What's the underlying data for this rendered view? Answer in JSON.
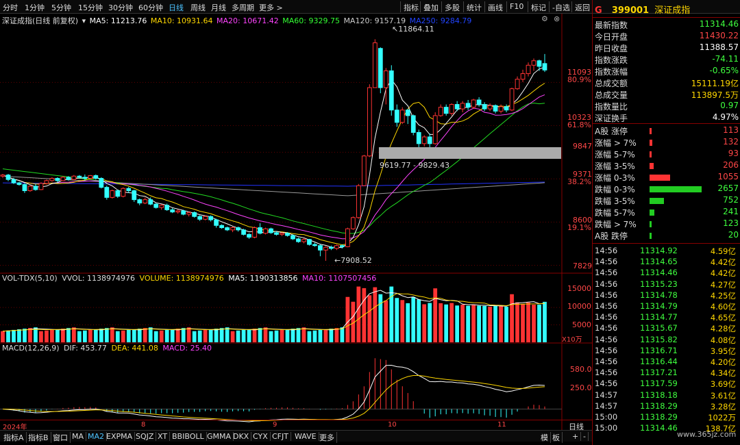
{
  "toolbar": {
    "timeframes": [
      "分时",
      "1分钟",
      "5分钟",
      "15分钟",
      "30分钟",
      "60分钟",
      "日线",
      "周线",
      "月线",
      "多周期",
      "更多 >"
    ],
    "active_timeframe": "日线",
    "right_buttons": [
      "指标",
      "叠加",
      "多股",
      "统计",
      "画线",
      "F10",
      "标记",
      "-自选",
      "返回"
    ]
  },
  "chart_header": {
    "name": "深证成指(日线 前复权)",
    "ma5": "MA5: 11213.76",
    "ma10": "MA10: 10931.64",
    "ma20": "MA20: 10671.42",
    "ma60": "MA60: 9329.75",
    "ma120": "MA120: 9157.19",
    "ma250": "MA250: 9284.79"
  },
  "price_axis": {
    "labels": [
      "11093",
      "80.9%",
      "10323",
      "61.8%",
      "9847",
      "9371",
      "38.2%",
      "8600",
      "19.1%",
      "7829"
    ]
  },
  "annotations": {
    "high": "11864.11",
    "low": "7908.52",
    "gap": "9619.77 - 9829.43"
  },
  "volume_panel": {
    "legend": "VOL-TDX(5,10)",
    "vvol": "VVOL: 1138974976",
    "volume": "VOLUME: 1138974976",
    "ma5": "MA5: 1190313856",
    "ma10": "MA10: 1107507456",
    "axis": [
      "15000",
      "10000",
      "5000"
    ],
    "unit": "X10万"
  },
  "macd_panel": {
    "legend": "MACD(12,26,9)",
    "dif": "DIF: 453.77",
    "dea": "DEA: 441.08",
    "macd": "MACD: 25.40",
    "axis": [
      "580.0",
      "250.0"
    ]
  },
  "date_axis": {
    "labels": [
      "2024年",
      "8",
      "9",
      "10",
      "11"
    ],
    "period": "日线"
  },
  "bottom_tabs": {
    "items": [
      "指标A",
      "指标B",
      "窗口",
      "MA",
      "MA2",
      "EXPMA",
      "SQJZ",
      "XT",
      "BBIBOLL",
      "GMMA",
      "DKX",
      "CYX",
      "CFJT",
      "WAVE",
      "更多"
    ],
    "active": "MA2",
    "right": [
      "模",
      "板",
      "+",
      "-"
    ]
  },
  "quote": {
    "code": "399001",
    "name": "深证成指",
    "rows": [
      {
        "label": "最新指数",
        "value": "11314.46",
        "color": "#3fff3f"
      },
      {
        "label": "今日开盘",
        "value": "11430.22",
        "color": "#ff4747"
      },
      {
        "label": "昨日收盘",
        "value": "11388.57",
        "color": "#ffffff"
      },
      {
        "label": "指数涨跌",
        "value": "-74.11",
        "color": "#3fff3f"
      },
      {
        "label": "指数涨幅",
        "value": "-0.65%",
        "color": "#3fff3f"
      },
      {
        "label": "总成交额",
        "value": "15111.19亿",
        "color": "#ffd700"
      },
      {
        "label": "总成交量",
        "value": "113897.5万",
        "color": "#ffd700"
      },
      {
        "label": "指数量比",
        "value": "0.97",
        "color": "#3fff3f"
      },
      {
        "label": "深证换手",
        "value": "4.97%",
        "color": "#ffffff"
      }
    ]
  },
  "breadth": {
    "rows": [
      {
        "label": "A股 涨停",
        "value": "113",
        "ratio": 0.04,
        "color": "#ff3333"
      },
      {
        "label": "涨幅 > 7%",
        "value": "132",
        "ratio": 0.05,
        "color": "#ff3333"
      },
      {
        "label": "涨幅 5-7%",
        "value": "93",
        "ratio": 0.035,
        "color": "#ff3333"
      },
      {
        "label": "涨幅 3-5%",
        "value": "206",
        "ratio": 0.08,
        "color": "#ff3333"
      },
      {
        "label": "涨幅 0-3%",
        "value": "1055",
        "ratio": 0.4,
        "color": "#ff3333"
      },
      {
        "label": "跌幅 0-3%",
        "value": "2657",
        "ratio": 1.0,
        "color": "#22cc22"
      },
      {
        "label": "跌幅 3-5%",
        "value": "752",
        "ratio": 0.28,
        "color": "#22cc22"
      },
      {
        "label": "跌幅 5-7%",
        "value": "241",
        "ratio": 0.09,
        "color": "#22cc22"
      },
      {
        "label": "跌幅 > 7%",
        "value": "123",
        "ratio": 0.046,
        "color": "#22cc22"
      },
      {
        "label": "A股 跌停",
        "value": "20",
        "ratio": 0.008,
        "color": "#22cc22"
      }
    ]
  },
  "ticks": [
    {
      "time": "14:56",
      "price": "11314.92",
      "amount": "4.59亿"
    },
    {
      "time": "14:56",
      "price": "11314.65",
      "amount": "4.42亿"
    },
    {
      "time": "14:56",
      "price": "11314.46",
      "amount": "4.42亿"
    },
    {
      "time": "14:56",
      "price": "11315.23",
      "amount": "4.27亿"
    },
    {
      "time": "14:56",
      "price": "11314.78",
      "amount": "4.25亿"
    },
    {
      "time": "14:56",
      "price": "11314.79",
      "amount": "4.60亿"
    },
    {
      "time": "14:56",
      "price": "11314.77",
      "amount": "4.65亿"
    },
    {
      "time": "14:56",
      "price": "11315.67",
      "amount": "4.28亿"
    },
    {
      "time": "14:56",
      "price": "11315.82",
      "amount": "4.08亿"
    },
    {
      "time": "14:56",
      "price": "11316.71",
      "amount": "3.95亿"
    },
    {
      "time": "14:56",
      "price": "11316.44",
      "amount": "4.20亿"
    },
    {
      "time": "14:56",
      "price": "11317.21",
      "amount": "4.34亿"
    },
    {
      "time": "14:56",
      "price": "11317.59",
      "amount": "3.69亿"
    },
    {
      "time": "14:57",
      "price": "11318.18",
      "amount": "3.61亿"
    },
    {
      "time": "14:57",
      "price": "11318.29",
      "amount": "3.28亿"
    },
    {
      "time": "15:00",
      "price": "11318.29",
      "amount": "1022万"
    },
    {
      "time": "15:00",
      "price": "11314.46",
      "amount": "138.7亿"
    }
  ],
  "watermark": "www.365jz.com",
  "chart_data": {
    "type": "candlestick",
    "price_range": [
      7700,
      12100
    ],
    "candles": [
      [
        9420,
        9440,
        9390,
        9460
      ],
      [
        9440,
        9360,
        9330,
        9460
      ],
      [
        9360,
        9300,
        9280,
        9390
      ],
      [
        9300,
        9270,
        9250,
        9320
      ],
      [
        9270,
        9160,
        9120,
        9290
      ],
      [
        9160,
        9240,
        9140,
        9260
      ],
      [
        9240,
        9180,
        9160,
        9280
      ],
      [
        9180,
        9290,
        9170,
        9310
      ],
      [
        9290,
        9340,
        9270,
        9360
      ],
      [
        9340,
        9380,
        9320,
        9400
      ],
      [
        9380,
        9340,
        9310,
        9400
      ],
      [
        9340,
        9400,
        9330,
        9420
      ],
      [
        9400,
        9360,
        9340,
        9420
      ],
      [
        9360,
        9420,
        9340,
        9440
      ],
      [
        9420,
        9400,
        9380,
        9440
      ],
      [
        9400,
        9380,
        9340,
        9450
      ],
      [
        9380,
        9430,
        9360,
        9440
      ],
      [
        9430,
        9380,
        9360,
        9450
      ],
      [
        9380,
        9220,
        9200,
        9400
      ],
      [
        9220,
        9040,
        9000,
        9250
      ],
      [
        9040,
        9160,
        9020,
        9180
      ],
      [
        9160,
        9060,
        9030,
        9180
      ],
      [
        9060,
        9200,
        9040,
        9220
      ],
      [
        9200,
        9160,
        9120,
        9230
      ],
      [
        9160,
        9000,
        8960,
        9180
      ],
      [
        9000,
        8940,
        8900,
        9020
      ],
      [
        8940,
        9000,
        8920,
        9040
      ],
      [
        9000,
        8920,
        8900,
        9040
      ],
      [
        8920,
        8860,
        8840,
        8940
      ],
      [
        8860,
        8900,
        8820,
        8920
      ],
      [
        8900,
        8820,
        8800,
        8930
      ],
      [
        8820,
        8780,
        8760,
        8850
      ],
      [
        8780,
        8800,
        8750,
        8830
      ],
      [
        8800,
        8740,
        8720,
        8820
      ],
      [
        8740,
        8770,
        8700,
        8790
      ],
      [
        8770,
        8700,
        8680,
        8790
      ],
      [
        8700,
        8650,
        8620,
        8720
      ],
      [
        8650,
        8700,
        8630,
        8720
      ],
      [
        8700,
        8640,
        8610,
        8720
      ],
      [
        8640,
        8540,
        8500,
        8660
      ],
      [
        8540,
        8500,
        8480,
        8560
      ],
      [
        8500,
        8460,
        8440,
        8520
      ],
      [
        8460,
        8500,
        8420,
        8520
      ],
      [
        8500,
        8460,
        8430,
        8520
      ],
      [
        8460,
        8380,
        8360,
        8480
      ],
      [
        8380,
        8330,
        8300,
        8400
      ],
      [
        8330,
        8500,
        8310,
        8520
      ],
      [
        8500,
        8400,
        8380,
        8580
      ],
      [
        8400,
        8480,
        8380,
        8500
      ],
      [
        8480,
        8410,
        8390,
        8500
      ],
      [
        8410,
        8380,
        8360,
        8440
      ],
      [
        8380,
        8400,
        8350,
        8420
      ],
      [
        8400,
        8360,
        8340,
        8420
      ],
      [
        8360,
        8300,
        8280,
        8380
      ],
      [
        8300,
        8250,
        8230,
        8320
      ],
      [
        8250,
        8290,
        8220,
        8310
      ],
      [
        8290,
        8200,
        8180,
        8300
      ],
      [
        8200,
        8180,
        8160,
        8230
      ],
      [
        8180,
        8100,
        7990,
        8200
      ],
      [
        8100,
        8150,
        7908,
        8170
      ],
      [
        8150,
        8130,
        8100,
        8180
      ],
      [
        8130,
        8180,
        8100,
        8200
      ],
      [
        8180,
        8160,
        8130,
        8200
      ],
      [
        8160,
        8480,
        8150,
        8500
      ],
      [
        8480,
        8680,
        8460,
        8700
      ],
      [
        8680,
        9250,
        8660,
        9280
      ],
      [
        9250,
        9780,
        9240,
        9800
      ],
      [
        9780,
        11000,
        9760,
        11060
      ],
      [
        11000,
        11800,
        11200,
        11864
      ],
      [
        11700,
        11000,
        10900,
        11720
      ],
      [
        11000,
        11300,
        10700,
        11350
      ],
      [
        11300,
        10600,
        10500,
        11400
      ],
      [
        10600,
        10380,
        10300,
        10700
      ],
      [
        10380,
        10600,
        10350,
        10650
      ],
      [
        10600,
        10500,
        10350,
        10620
      ],
      [
        10500,
        10200,
        10150,
        10520
      ],
      [
        10200,
        10000,
        9900,
        10250
      ],
      [
        10000,
        10120,
        9950,
        10150
      ],
      [
        10120,
        10000,
        9920,
        10180
      ],
      [
        10000,
        10500,
        9980,
        10560
      ],
      [
        10500,
        10650,
        10480,
        10700
      ],
      [
        10650,
        10540,
        10500,
        10700
      ],
      [
        10540,
        10700,
        10500,
        10720
      ],
      [
        10700,
        10620,
        10580,
        10760
      ],
      [
        10620,
        10720,
        10560,
        10760
      ],
      [
        10720,
        10650,
        10600,
        10780
      ],
      [
        10650,
        10780,
        10620,
        10800
      ],
      [
        10780,
        10700,
        10660,
        10830
      ],
      [
        10700,
        10620,
        10580,
        10740
      ],
      [
        10620,
        10680,
        10580,
        10720
      ],
      [
        10680,
        10580,
        10540,
        10700
      ],
      [
        10580,
        10660,
        10540,
        10700
      ],
      [
        10660,
        10600,
        10560,
        10700
      ],
      [
        10600,
        10980,
        10580,
        11000
      ],
      [
        10980,
        11150,
        10960,
        11200
      ],
      [
        11150,
        11250,
        11100,
        11320
      ],
      [
        11250,
        11400,
        11200,
        11450
      ],
      [
        11400,
        11480,
        11300,
        11520
      ],
      [
        11480,
        11380,
        11300,
        11500
      ],
      [
        11430,
        11314,
        11280,
        11600
      ]
    ],
    "volume_range": [
      0,
      16500
    ],
    "macd_range": [
      -150,
      800
    ]
  }
}
